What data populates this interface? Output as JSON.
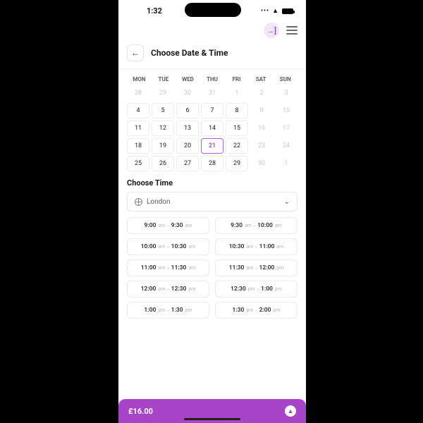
{
  "status": {
    "time": "1:32"
  },
  "header": {
    "title": "Choose Date & Time"
  },
  "calendar": {
    "dow": [
      "MON",
      "TUE",
      "WED",
      "THU",
      "FRI",
      "SAT",
      "SUN"
    ],
    "cells": [
      {
        "n": "28",
        "muted": true,
        "nob": true
      },
      {
        "n": "29",
        "muted": true,
        "nob": true
      },
      {
        "n": "30",
        "muted": true,
        "nob": true
      },
      {
        "n": "31",
        "muted": true,
        "nob": true
      },
      {
        "n": "1",
        "muted": true,
        "nob": true
      },
      {
        "n": "2",
        "muted": true,
        "nob": true
      },
      {
        "n": "3",
        "muted": true,
        "nob": true
      },
      {
        "n": "4"
      },
      {
        "n": "5"
      },
      {
        "n": "6"
      },
      {
        "n": "7"
      },
      {
        "n": "8"
      },
      {
        "n": "9",
        "muted": true,
        "nob": true
      },
      {
        "n": "10",
        "muted": true,
        "nob": true
      },
      {
        "n": "11"
      },
      {
        "n": "12"
      },
      {
        "n": "13"
      },
      {
        "n": "14"
      },
      {
        "n": "15"
      },
      {
        "n": "16",
        "muted": true,
        "nob": true
      },
      {
        "n": "17",
        "muted": true,
        "nob": true
      },
      {
        "n": "18"
      },
      {
        "n": "19"
      },
      {
        "n": "20"
      },
      {
        "n": "21",
        "selected": true
      },
      {
        "n": "22"
      },
      {
        "n": "23",
        "muted": true,
        "nob": true
      },
      {
        "n": "24",
        "muted": true,
        "nob": true
      },
      {
        "n": "25"
      },
      {
        "n": "26"
      },
      {
        "n": "27"
      },
      {
        "n": "28"
      },
      {
        "n": "29"
      },
      {
        "n": "30",
        "muted": true,
        "nob": true
      },
      {
        "n": "1",
        "muted": true,
        "nob": true
      }
    ]
  },
  "time": {
    "title": "Choose Time",
    "tz": "London",
    "slots": [
      {
        "s": "9:00",
        "sm": "am",
        "e": "9:30",
        "em": "am"
      },
      {
        "s": "9:30",
        "sm": "am",
        "e": "10:00",
        "em": "am"
      },
      {
        "s": "10:00",
        "sm": "am",
        "e": "10:30",
        "em": "am"
      },
      {
        "s": "10:30",
        "sm": "am",
        "e": "11:00",
        "em": "am"
      },
      {
        "s": "11:00",
        "sm": "am",
        "e": "11:30",
        "em": "am"
      },
      {
        "s": "11:30",
        "sm": "am",
        "e": "12:00",
        "em": "pm"
      },
      {
        "s": "12:00",
        "sm": "pm",
        "e": "12:30",
        "em": "pm"
      },
      {
        "s": "12:30",
        "sm": "pm",
        "e": "1:00",
        "em": "pm"
      },
      {
        "s": "1:00",
        "sm": "pm",
        "e": "1:30",
        "em": "pm"
      },
      {
        "s": "1:30",
        "sm": "pm",
        "e": "2:00",
        "em": "pm"
      }
    ]
  },
  "footer": {
    "price": "£16.00"
  }
}
